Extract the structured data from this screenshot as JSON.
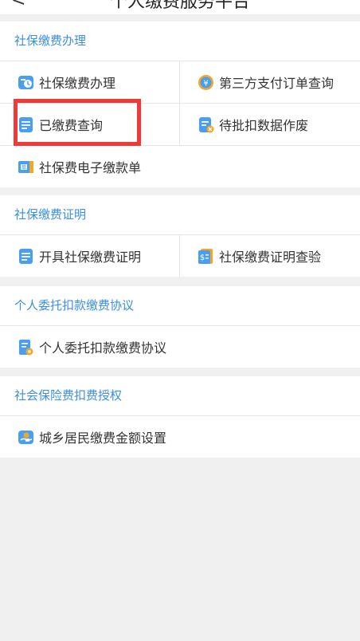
{
  "header": {
    "back_glyph": "<",
    "title": "个人缴费服务平台"
  },
  "sections": [
    {
      "title": "社保缴费办理",
      "items": [
        {
          "label": "社保缴费办理",
          "icon": "payment-clock-icon"
        },
        {
          "label": "第三方支付订单查询",
          "icon": "yuan-coin-icon"
        },
        {
          "label": "已缴费查询",
          "icon": "document-list-icon"
        },
        {
          "label": "待批扣数据作废",
          "icon": "document-cancel-icon"
        },
        {
          "label": "社保费电子缴款单",
          "icon": "receipt-book-icon"
        }
      ]
    },
    {
      "title": "社保缴费证明",
      "items": [
        {
          "label": "开具社保缴费证明",
          "icon": "document-list-icon"
        },
        {
          "label": "社保缴费证明查验",
          "icon": "dollar-document-icon"
        }
      ]
    },
    {
      "title": "个人委托扣款缴费协议",
      "items": [
        {
          "label": "个人委托扣款缴费协议",
          "icon": "agreement-document-icon"
        }
      ]
    },
    {
      "title": "社会保险费扣费授权",
      "items": [
        {
          "label": "城乡居民缴费金额设置",
          "icon": "hand-coin-icon"
        }
      ]
    }
  ],
  "colors": {
    "accent": "#3a8ee6",
    "highlight": "#ef3a37",
    "icon_orange": "#f5a623"
  }
}
